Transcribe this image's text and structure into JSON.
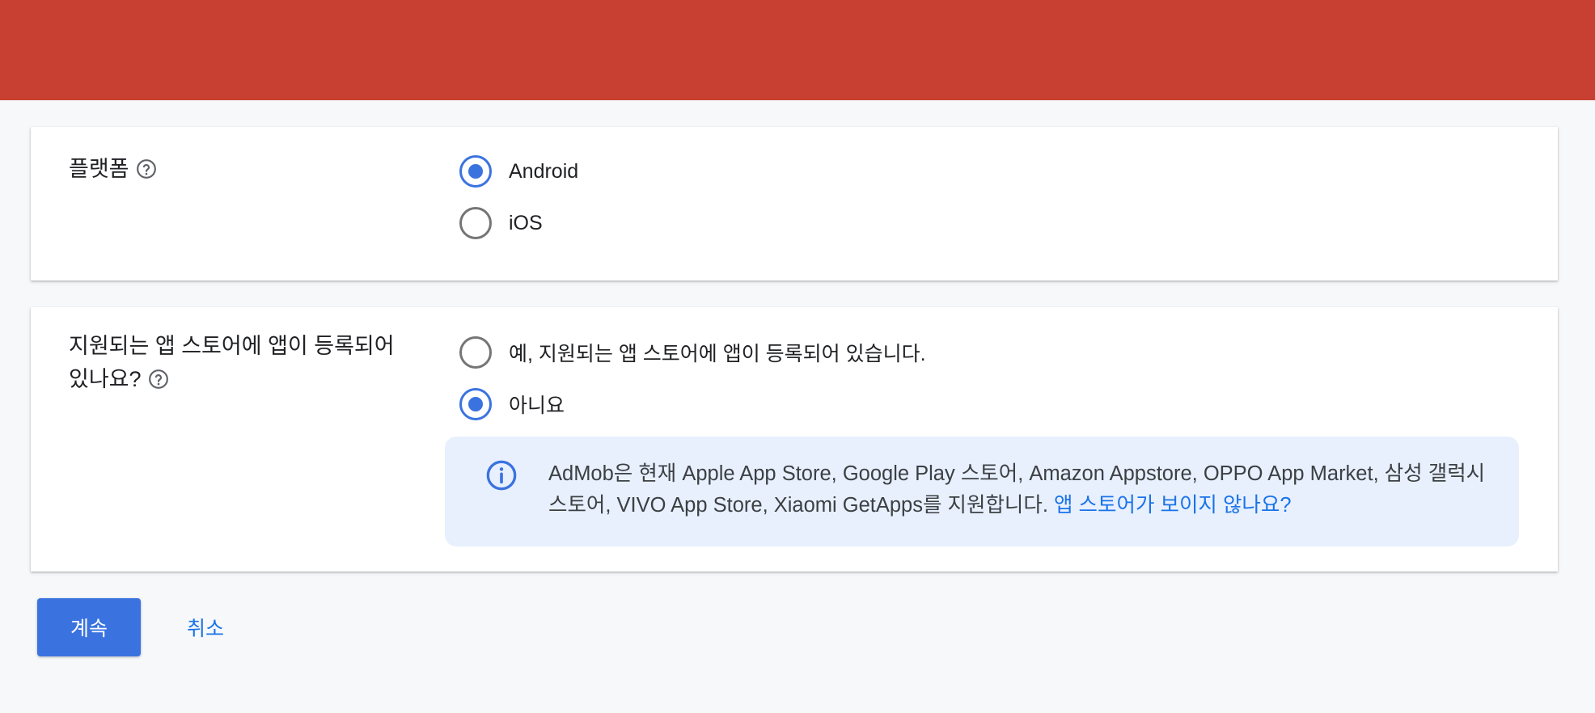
{
  "colors": {
    "header": "#c84031",
    "accent": "#3a73e0",
    "link": "#1a73e8",
    "info_background": "#e8f0fe"
  },
  "platform": {
    "label": "플랫폼",
    "help_icon": "help-circle-icon",
    "options": [
      {
        "label": "Android",
        "selected": true
      },
      {
        "label": "iOS",
        "selected": false
      }
    ]
  },
  "store": {
    "label": "지원되는 앱 스토어에 앱이 등록되어 있나요?",
    "help_icon": "help-circle-icon",
    "options": [
      {
        "label": "예, 지원되는 앱 스토어에 앱이 등록되어 있습니다.",
        "selected": false
      },
      {
        "label": "아니요",
        "selected": true
      }
    ],
    "info": {
      "icon": "info-icon",
      "text": "AdMob은 현재 Apple App Store, Google Play 스토어, Amazon Appstore, OPPO App Market, 삼성 갤럭시 스토어, VIVO App Store, Xiaomi GetApps를 지원합니다.",
      "link": "앱 스토어가 보이지 않나요?"
    }
  },
  "actions": {
    "continue_label": "계속",
    "cancel_label": "취소"
  }
}
